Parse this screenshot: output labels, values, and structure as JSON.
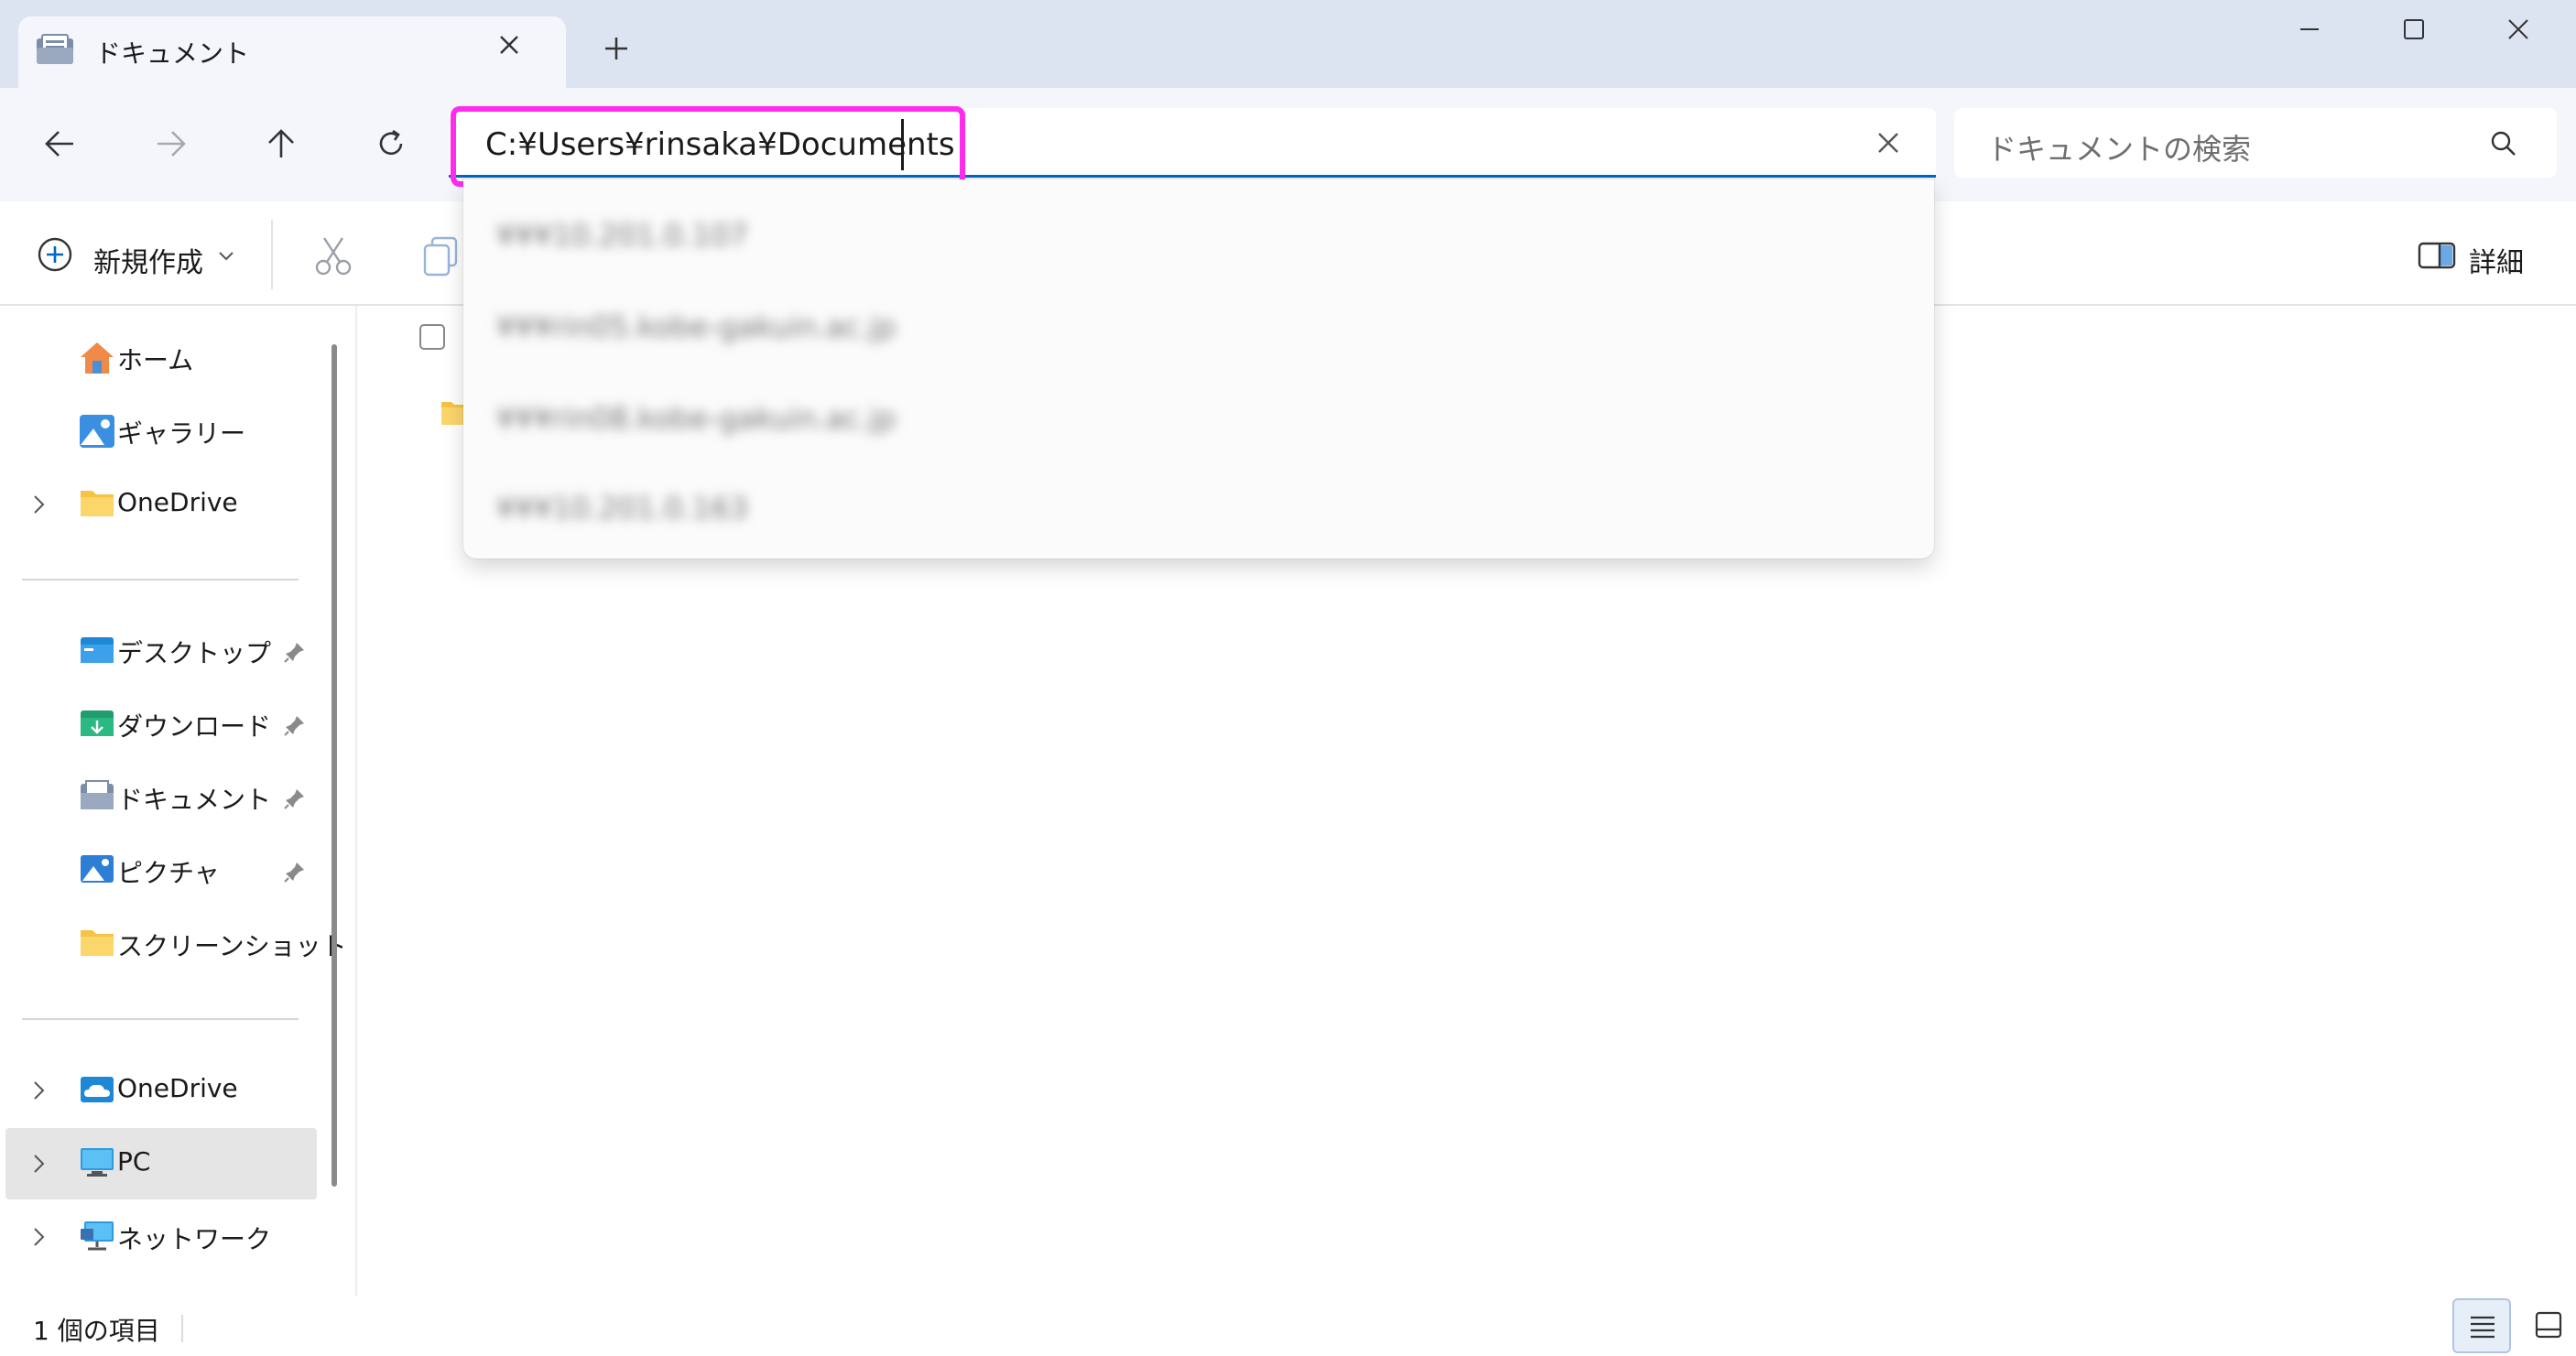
{
  "window": {
    "tab_title": "ドキュメント",
    "new_tab_label": "+"
  },
  "address": {
    "path": "C:¥Users¥rinsaka¥Documents"
  },
  "search": {
    "placeholder": "ドキュメントの検索"
  },
  "suggestions": [
    "¥¥¥10.201.0.107",
    "¥¥¥rin05.kobe-gakuin.ac.jp",
    "¥¥¥rin08.kobe-gakuin.ac.jp",
    "¥¥¥10.201.0.163"
  ],
  "commandbar": {
    "new_label": "新規作成",
    "details_label": "詳細"
  },
  "sidebar": {
    "quick": [
      {
        "label": "ホーム",
        "icon": "home-icon"
      },
      {
        "label": "ギャラリー",
        "icon": "gallery-icon"
      },
      {
        "label": "OneDrive",
        "icon": "folder-icon"
      }
    ],
    "pinned": [
      {
        "label": "デスクトップ",
        "icon": "desktop-folder-icon"
      },
      {
        "label": "ダウンロード",
        "icon": "downloads-folder-icon"
      },
      {
        "label": "ドキュメント",
        "icon": "documents-folder-icon"
      },
      {
        "label": "ピクチャ",
        "icon": "pictures-folder-icon"
      },
      {
        "label": "スクリーンショット",
        "icon": "folder-icon"
      }
    ],
    "locations": [
      {
        "label": "OneDrive",
        "icon": "onedrive-cloud-icon"
      },
      {
        "label": "PC",
        "icon": "pc-icon"
      },
      {
        "label": "ネットワーク",
        "icon": "network-icon"
      }
    ]
  },
  "status": {
    "item_count": "1 個の項目"
  },
  "colors": {
    "titlebar": "#dde4f1",
    "accent": "#0067c0",
    "highlight": "#ff2cf0",
    "folder": "#f6c343"
  }
}
